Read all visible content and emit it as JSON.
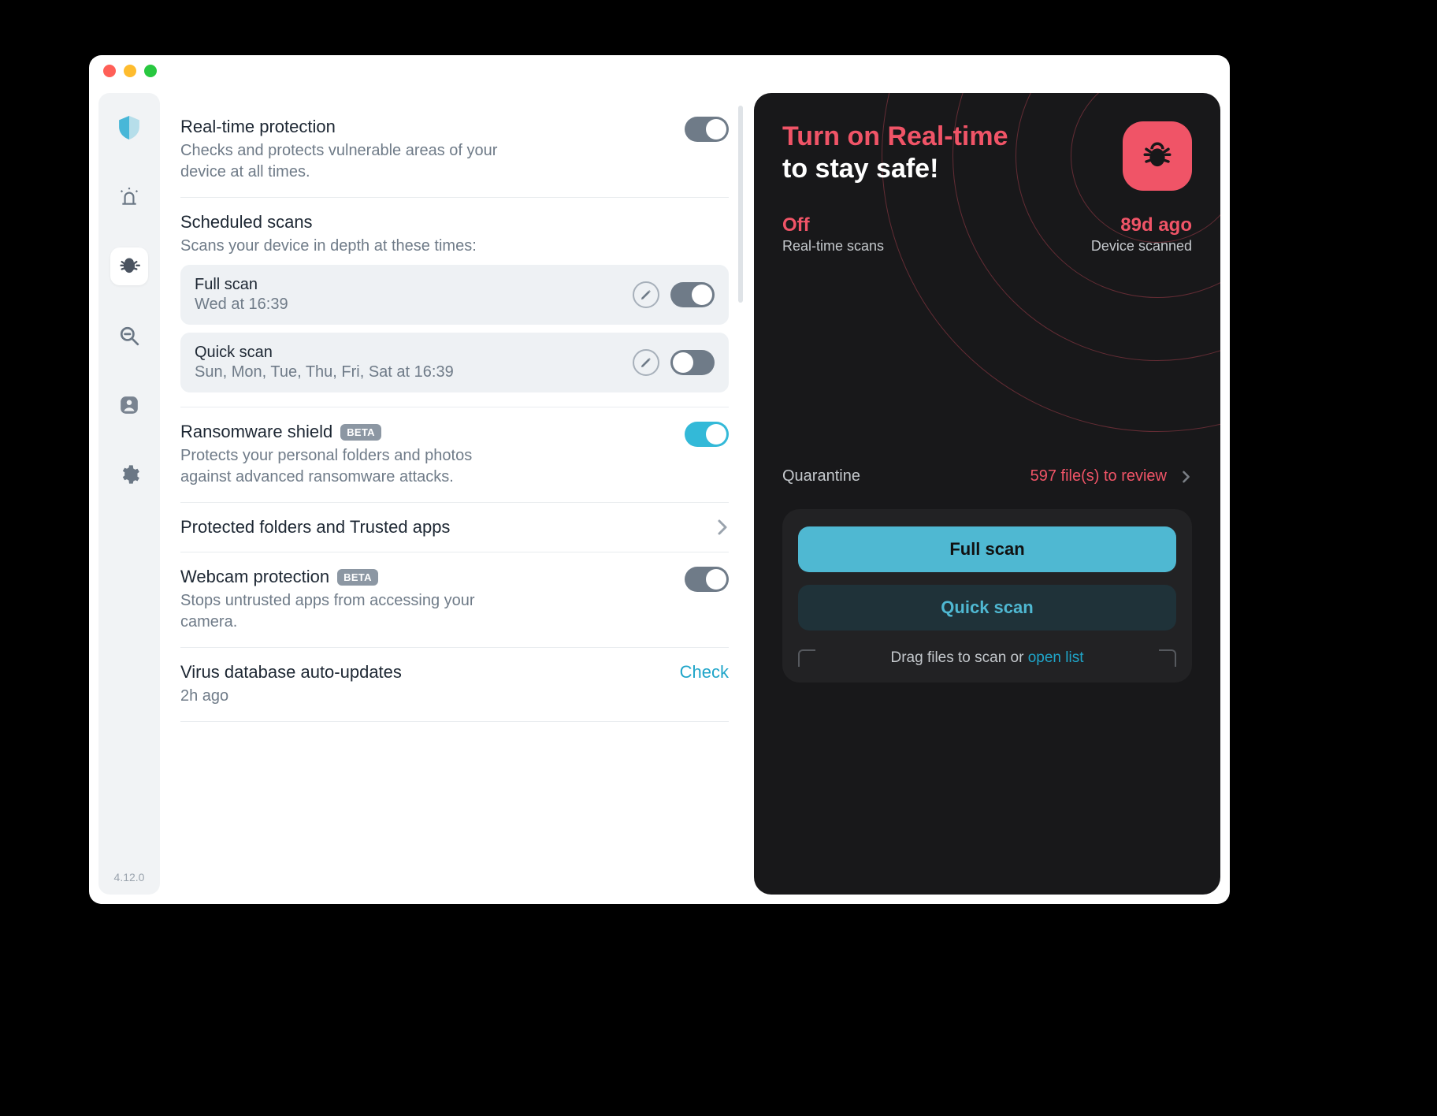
{
  "version": "4.12.0",
  "realtime": {
    "title": "Real-time protection",
    "desc": "Checks and protects vulnerable areas of your device at all times."
  },
  "scheduled": {
    "title": "Scheduled scans",
    "desc": "Scans your device in depth at these times:",
    "items": [
      {
        "title": "Full scan",
        "time": "Wed at 16:39"
      },
      {
        "title": "Quick scan",
        "time": "Sun, Mon, Tue, Thu, Fri, Sat at 16:39"
      }
    ]
  },
  "ransomware": {
    "title": "Ransomware shield",
    "beta": "BETA",
    "desc": "Protects your personal folders and photos against advanced ransomware attacks."
  },
  "protected_row": "Protected folders and Trusted apps",
  "webcam": {
    "title": "Webcam protection",
    "beta": "BETA",
    "desc": "Stops untrusted apps from accessing your camera."
  },
  "db": {
    "title": "Virus database auto-updates",
    "time": "2h ago",
    "action": "Check"
  },
  "panel": {
    "hero1": "Turn on Real-time",
    "hero2": "to stay safe!",
    "status": {
      "left_val": "Off",
      "left_label": "Real-time scans",
      "right_val": "89d ago",
      "right_label": "Device scanned"
    },
    "quarantine_label": "Quarantine",
    "quarantine_files": "597 file(s) to review",
    "full_scan": "Full scan",
    "quick_scan": "Quick scan",
    "drop_text": "Drag files to scan or ",
    "drop_link": "open list"
  }
}
